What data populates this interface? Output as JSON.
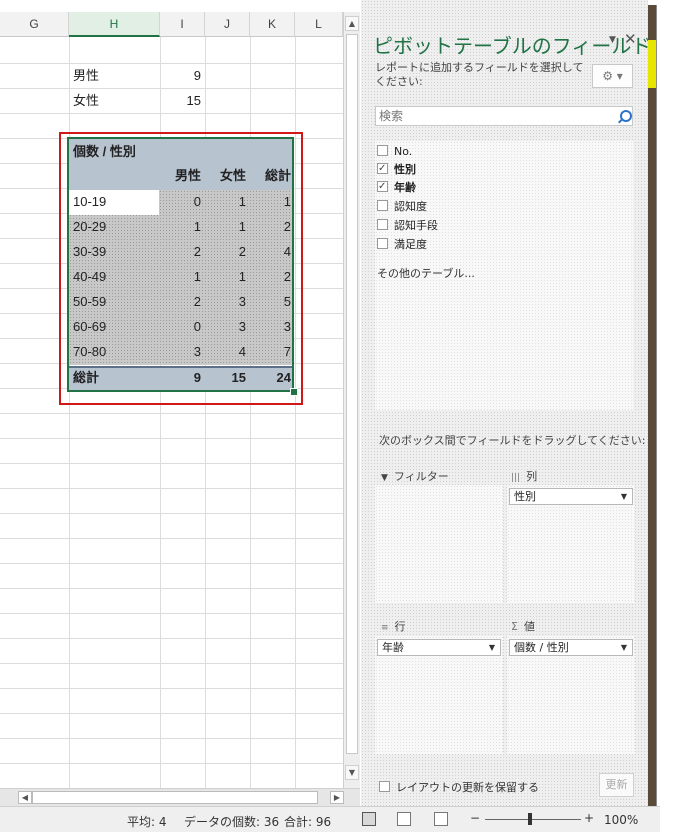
{
  "columns": [
    "G",
    "H",
    "I",
    "J",
    "K",
    "L"
  ],
  "selected_column": "H",
  "cells": {
    "male_label": "男性",
    "male_value": "9",
    "female_label": "女性",
    "female_value": "15"
  },
  "pivot": {
    "title": "個数 / 性別",
    "headers": [
      "男性",
      "女性",
      "総計"
    ],
    "rows": [
      {
        "label": "10-19",
        "male": "0",
        "female": "1",
        "total": "1"
      },
      {
        "label": "20-29",
        "male": "1",
        "female": "1",
        "total": "2"
      },
      {
        "label": "30-39",
        "male": "2",
        "female": "2",
        "total": "4"
      },
      {
        "label": "40-49",
        "male": "1",
        "female": "1",
        "total": "2"
      },
      {
        "label": "50-59",
        "male": "2",
        "female": "3",
        "total": "5"
      },
      {
        "label": "60-69",
        "male": "0",
        "female": "3",
        "total": "3"
      },
      {
        "label": "70-80",
        "male": "3",
        "female": "4",
        "total": "7"
      }
    ],
    "grand_total": {
      "label": "総計",
      "male": "9",
      "female": "15",
      "total": "24"
    }
  },
  "panel": {
    "title": "ピボットテーブルのフィールド",
    "description": "レポートに追加するフィールドを選択してください:",
    "search_placeholder": "検索",
    "fields": [
      {
        "label": "No.",
        "checked": false
      },
      {
        "label": "性別",
        "checked": true
      },
      {
        "label": "年齢",
        "checked": true
      },
      {
        "label": "認知度",
        "checked": false
      },
      {
        "label": "認知手段",
        "checked": false
      },
      {
        "label": "満足度",
        "checked": false
      }
    ],
    "more_tables": "その他のテーブル...",
    "drag_instruction": "次のボックス間でフィールドをドラッグしてください:",
    "areas": {
      "filter": {
        "label": "フィルター",
        "field": ""
      },
      "columns": {
        "label": "列",
        "field": "性別"
      },
      "rows": {
        "label": "行",
        "field": "年齢"
      },
      "values": {
        "label": "値",
        "field": "個数 / 性別"
      }
    },
    "defer_update": "レイアウトの更新を保留する",
    "update_button": "更新"
  },
  "status": {
    "average": "平均: 4",
    "count": "データの個数: 36",
    "sum": "合計: 96",
    "zoom": "100%"
  },
  "colors": {
    "accent": "#217346",
    "pivot_header": "#b8c3d0",
    "highlight": "#d01818"
  }
}
